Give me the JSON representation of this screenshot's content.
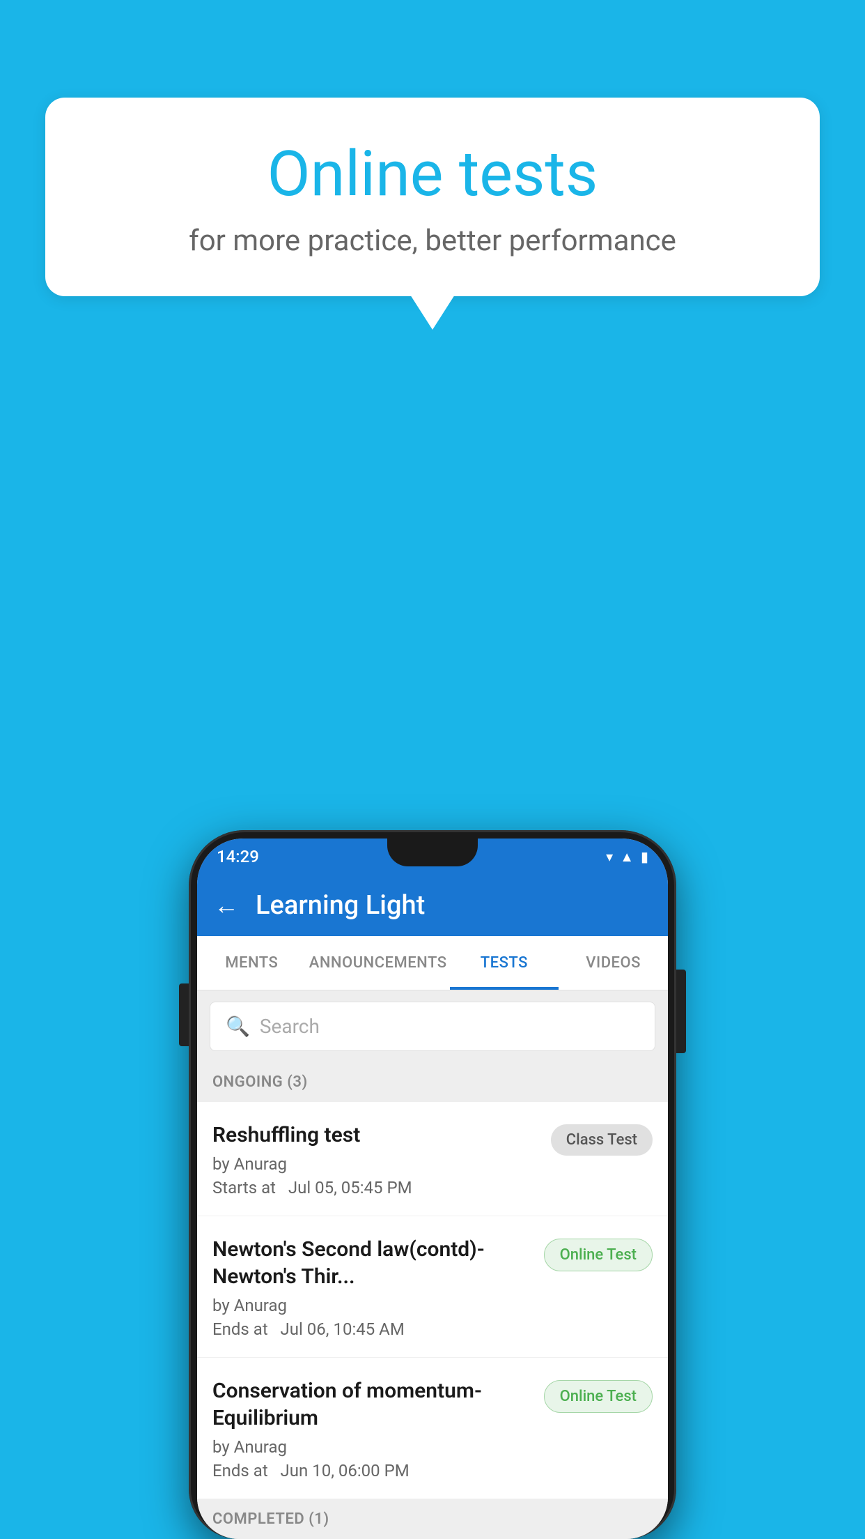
{
  "background": {
    "color": "#1ab5e8"
  },
  "speech_bubble": {
    "title": "Online tests",
    "subtitle": "for more practice, better performance"
  },
  "phone": {
    "status_bar": {
      "time": "14:29",
      "icons": [
        "wifi",
        "signal",
        "battery"
      ]
    },
    "app_header": {
      "back_label": "←",
      "title": "Learning Light"
    },
    "tabs": [
      {
        "label": "MENTS",
        "active": false
      },
      {
        "label": "ANNOUNCEMENTS",
        "active": false
      },
      {
        "label": "TESTS",
        "active": true
      },
      {
        "label": "VIDEOS",
        "active": false
      }
    ],
    "search": {
      "placeholder": "Search"
    },
    "sections": [
      {
        "header": "ONGOING (3)",
        "tests": [
          {
            "name": "Reshuffling test",
            "author": "by Anurag",
            "time_label": "Starts at",
            "time": "Jul 05, 05:45 PM",
            "badge": "Class Test",
            "badge_type": "class"
          },
          {
            "name": "Newton's Second law(contd)-Newton's Thir...",
            "author": "by Anurag",
            "time_label": "Ends at",
            "time": "Jul 06, 10:45 AM",
            "badge": "Online Test",
            "badge_type": "online"
          },
          {
            "name": "Conservation of momentum-Equilibrium",
            "author": "by Anurag",
            "time_label": "Ends at",
            "time": "Jun 10, 06:00 PM",
            "badge": "Online Test",
            "badge_type": "online"
          }
        ]
      }
    ],
    "completed_section": {
      "header": "COMPLETED (1)"
    }
  }
}
